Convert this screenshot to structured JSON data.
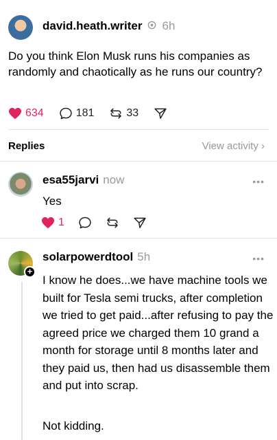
{
  "post": {
    "username": "david.heath.writer",
    "time": "6h",
    "text": "Do you think Elon Musk runs his companies as randomly and chaotically as he runs our country?",
    "likes": "634",
    "comments": "181",
    "reposts": "33"
  },
  "replies_header": {
    "label": "Replies",
    "view_activity": "View activity ›"
  },
  "reply1": {
    "username": "esa55jarvi",
    "time": "now",
    "text": "Yes",
    "likes": "1",
    "more": "•••"
  },
  "reply2": {
    "username": "solarpowerdtool",
    "time": "5h",
    "text": "I know he does...we have machine tools we built for Tesla semi trucks, after completion we tried to get paid...after refusing to pay the agreed price we charged them 10 grand a month for storage until 8 months later and they paid us, then had us disassemble them and put into scrap.",
    "text2": "Not kidding.",
    "more": "•••"
  },
  "colors": {
    "like": "#e0245e",
    "muted": "#9a9a9a"
  },
  "icons": [
    "heart-icon",
    "comment-icon",
    "repost-icon",
    "share-icon",
    "verified-icon",
    "more-icon",
    "follow-plus-icon"
  ]
}
